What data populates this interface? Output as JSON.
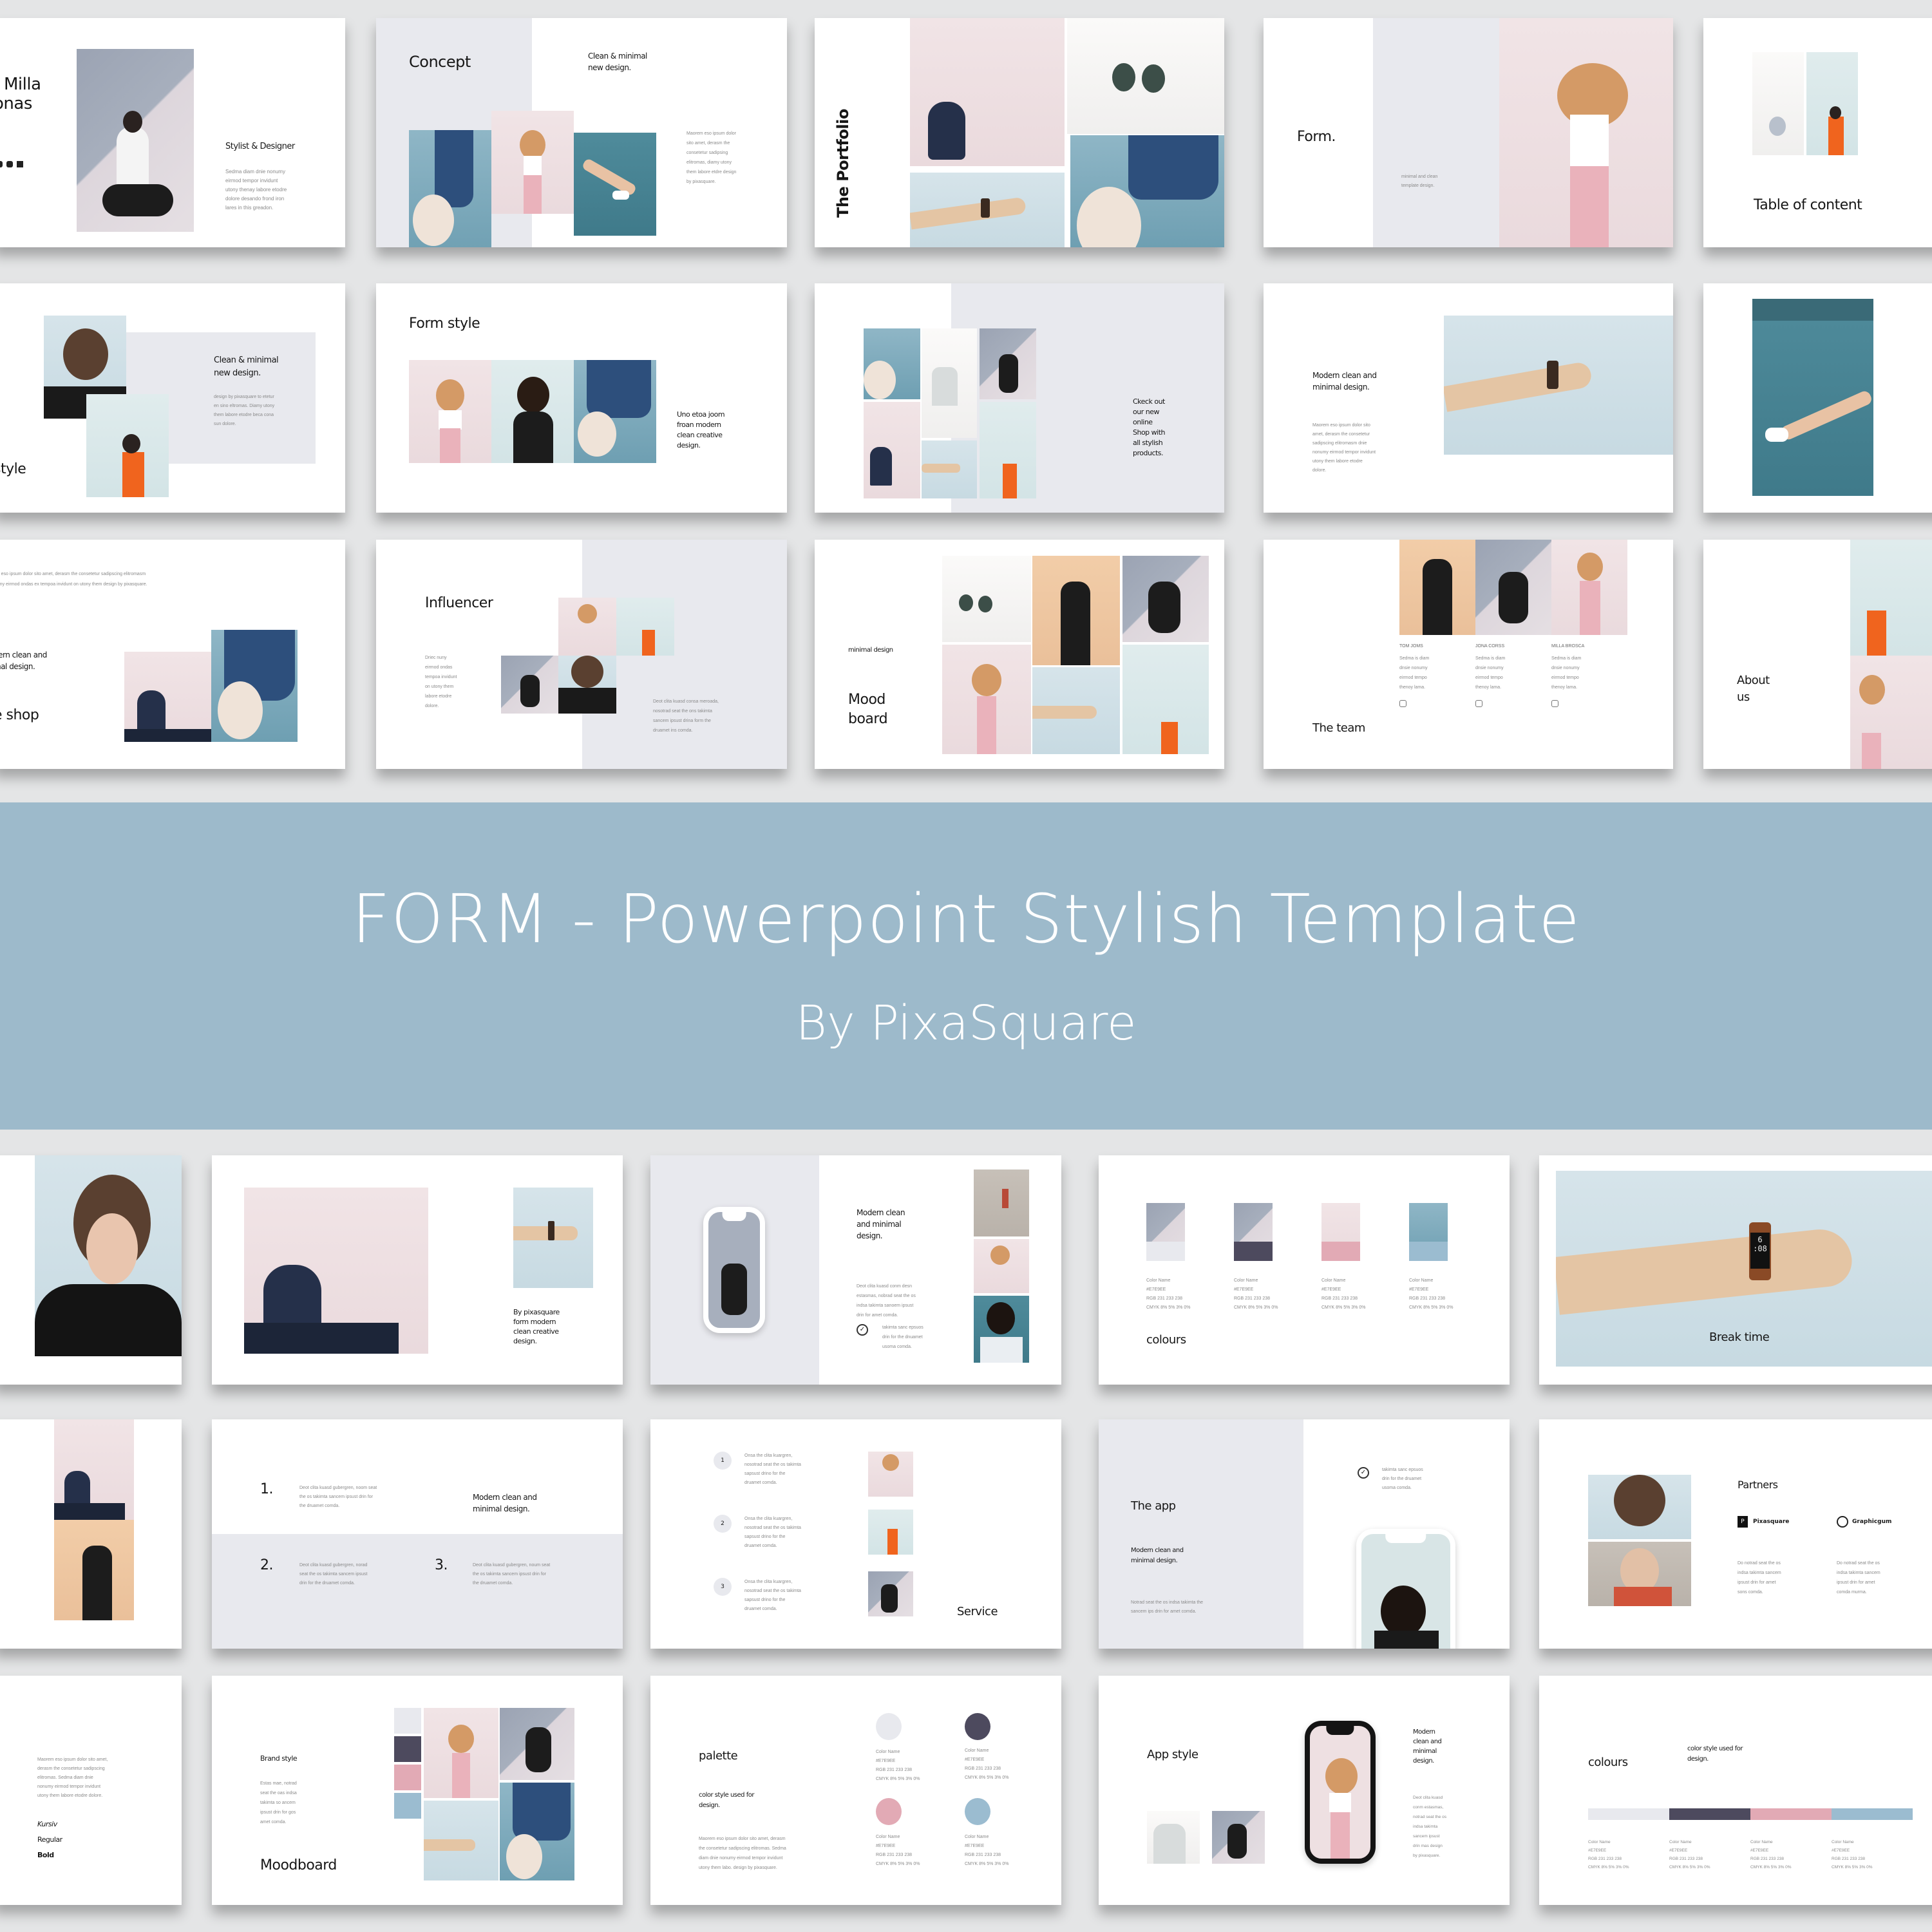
{
  "banner": {
    "title": "FORM - Powerpoint Stylish Template",
    "subtitle": "By PixaSquare",
    "color": "#9dbacb"
  },
  "palette": {
    "light_grey": "#e8e9ee",
    "dark_slate": "#4d4a5e",
    "pink": "#e2aab5",
    "blue": "#9bbcd0"
  },
  "slides_top": [
    {
      "id": "profile",
      "name_line1": "Milla",
      "name_line2": "onas",
      "subtitle": "Stylist & Designer",
      "body": "Sedma diam dnie nonumy\neirmod tempor invidunt\nutony thenay labore etodre\ndolore desando frond iron\nlares in this greadon.",
      "social_icons": [
        "instagram-icon",
        "youtube-icon",
        "mail-icon"
      ]
    },
    {
      "id": "concept",
      "title": "Concept",
      "heading": "Clean & minimal\nnew design.",
      "body": "Maorem eso ipsum dolor\nsito amet, derasm the\nconsetetur sadipsing\nelitromas, diamy utony\nthem labore etdre design\nby pixasquare."
    },
    {
      "id": "portfolio",
      "title": "The Portfolio"
    },
    {
      "id": "form",
      "title": "Form.",
      "body": "minimal and clean\ntemplate design."
    },
    {
      "id": "toc",
      "title": "Table of content"
    },
    {
      "id": "style",
      "title": "style",
      "heading": "Clean & minimal\nnew design.",
      "body": "design by pixasquare to etetur\nen sino eltromas. Diamy utony\nthem labore etodre beca cona\nsun dolore."
    },
    {
      "id": "form-style",
      "title": "Form style",
      "body": "Uno etoa joom\nfroan modern\nclean creative\ndesign."
    },
    {
      "id": "shop-grid",
      "body": "Ckeck out\nour new\nonline\nShop with\nall stylish\nproducts."
    },
    {
      "id": "modern-watch",
      "heading": "Modern clean and\nminimal design.",
      "body": "Maorem eso ipsum dolor sito\namet, derasm the consetetur\nsadipscing elitromasm dnie\nnonumy eirmod tempor invidunt\nutony them labore etodre\ndolore."
    },
    {
      "id": "legs"
    },
    {
      "id": "shop",
      "intro": "em eso ipsum dolor sito amet, derasm the consetetur sadipscing elitromasm\nnumy eirmod ondas ex tempoa invidunt on utony them design by pixasquare.",
      "heading": "dern clean and\nmal design.",
      "title": "e shop"
    },
    {
      "id": "influencer",
      "title": "Influencer",
      "body": "Driec nuny\neirmod ondas\ntempoa invidunt\non utony them\nlabore etodre\ndolore.",
      "body2": "Deot clita kuasd consa meroada,\nnosotrad seat the ons takimta\nsancem ipsust drina form the\ndruamet ins comda."
    },
    {
      "id": "moodboard",
      "caption": "minimal design",
      "title": "Mood\nboard"
    },
    {
      "id": "team",
      "title": "The team",
      "members": [
        {
          "name": "TOM JOMS",
          "bio": "Sedma is diam\ndnsie nonumy\neirmod tempo\nthenoy lama."
        },
        {
          "name": "JONA CORSS",
          "bio": "Sedma is diam\ndnsie nonumy\neirmod tempo\nthenoy lama."
        },
        {
          "name": "MILLA BROSCA",
          "bio": "Sedma is diam\ndnsie nonumy\neirmod tempo\nthenoy lama."
        }
      ]
    },
    {
      "id": "about",
      "title": "About\nus"
    }
  ],
  "slides_bottom": [
    {
      "id": "portrait"
    },
    {
      "id": "pixasquare",
      "body": "By pixasquare\nform modern\nclean creative\ndesign."
    },
    {
      "id": "phone-modern",
      "heading": "Modern clean\nand minimal\ndesign.",
      "body": "Deot clita kuasd conm desn\nestasmas, nobrad seat the os\nindsa takimta sanoem ipsust\ndrin for amet comda.",
      "check_text": "takimta sanc epsuos\ndrin for the dnuamet\nusoma comda."
    },
    {
      "id": "colours-photos",
      "title": "colours",
      "swatches": [
        {
          "name": "Color Name",
          "hex": "#E7E9EE",
          "rgb": "RGB 231  233  238",
          "cmyk": "CMYK 8%  5%  3%  0%"
        },
        {
          "name": "Color Name",
          "hex": "#E7E9EE",
          "rgb": "RGB 231  233  238",
          "cmyk": "CMYK 8%  5%  3%  0%"
        },
        {
          "name": "Color Name",
          "hex": "#E7E9EE",
          "rgb": "RGB 231  233  238",
          "cmyk": "CMYK 8%  5%  3%  0%"
        },
        {
          "name": "Color Name",
          "hex": "#E7E9EE",
          "rgb": "RGB 231  233  238",
          "cmyk": "CMYK 8%  5%  3%  0%"
        }
      ]
    },
    {
      "id": "break",
      "title": "Break time",
      "watch_time": "6\n:08"
    },
    {
      "id": "speaker-man"
    },
    {
      "id": "numbered",
      "heading": "Modern clean and\nminimal design.",
      "items": [
        {
          "num": "1.",
          "text": "Deot clita kuasd gubergren, noom seat\nthe os takimta sancem ipsust drin for\nthe druamet comda."
        },
        {
          "num": "2.",
          "text": "Deot clita kuasd gubergren, norad\nseat the os takimta sancem ipsust\ndrin for the druamet comda."
        },
        {
          "num": "3.",
          "text": "Deot clita kuasd gubergren, noum seat\nthe os takimta sancem ipsust drin for\nthe druamet comda."
        }
      ]
    },
    {
      "id": "service",
      "title": "Service",
      "steps": [
        {
          "num": "1",
          "text": "Onsa the clita kuargren,\nnosotrad seat the os takimta\nsapsust drino for the\ndruamet comda."
        },
        {
          "num": "2",
          "text": "Onsa the clita kuargren,\nnosotrad seat the os takimta\nsapsust drino for the\ndruamet comda."
        },
        {
          "num": "3",
          "text": "Onsa the clita kuargren,\nnosotrad seat the os takimta\nsapsust drino for the\ndruamet comda."
        }
      ]
    },
    {
      "id": "the-app",
      "title": "The app",
      "heading": "Modern clean and\nminimal design.",
      "body": "Notrad seat the os indsa takimta the\nsancem ips drin for amet comda.",
      "check_text": "takimta sanc epsuos\ndrin for the druamet\nusoma comda."
    },
    {
      "id": "partners",
      "title": "Partners",
      "partners": [
        {
          "name": "Pixasquare",
          "body": "Do notrad seat the os\nindsa takimta sancem\nipsust drin for amet\nsons comda."
        },
        {
          "name": "Graphicgum",
          "body": "Do notrad seat the os\nindsa takimta sancem\nipsust drin for amet\ncomda murma."
        }
      ]
    },
    {
      "id": "fonts",
      "body": "Maorem eso ipsum dolor sito amet,\nderasm the consetetur sadipscing\nelitromas. Sedma diam dnie\nnonumy eirmod tempor invidunt\nutony them labore etodre dolore.",
      "styles": [
        "Kursiv",
        "Regular",
        "Bold"
      ]
    },
    {
      "id": "moodboard2",
      "heading": "Brand style",
      "body": "Estas mae, notrad\nseat the oas indsa\ntakimta so ancem\nipsust drin for gos\namet comda.",
      "title": "Moodboard"
    },
    {
      "id": "palette",
      "title": "palette",
      "heading": "color style used for\ndesign.",
      "body": "Maorem eso ipsum dolor sito amet, derasm\nthe consetetur sadipscing elitromas. Sedma\ndiam dnie nonumy eirmod tempor invidunt\nutony them labo. design by pixasquare.",
      "swatches": [
        {
          "name": "Color Name",
          "hex": "#E7E9EE",
          "rgb": "RGB 231  233  238",
          "cmyk": "CMYK 8%  5%  3%  0%"
        },
        {
          "name": "Color Name",
          "hex": "#E7E9EE",
          "rgb": "RGB 231  233  238",
          "cmyk": "CMYK 8%  5%  3%  0%"
        },
        {
          "name": "Color Name",
          "hex": "#E7E9EE",
          "rgb": "RGB 231  233  238",
          "cmyk": "CMYK 8%  5%  3%  0%"
        },
        {
          "name": "Color Name",
          "hex": "#E7E9EE",
          "rgb": "RGB 231  233  238",
          "cmyk": "CMYK 8%  5%  3%  0%"
        }
      ]
    },
    {
      "id": "app-style",
      "title": "App style",
      "heading": "Modern\nclean and\nminimal\ndesign.",
      "body": "Deot clita kuasd\nconm estasmas,\nnotrad seat the os\nindsa takimta\nsancem ipsust\ndrin mas design\nby pixasquare."
    },
    {
      "id": "colours-bar",
      "title": "colours",
      "heading": "color style used for\ndesign.",
      "swatches": [
        {
          "name": "Color Name",
          "hex": "#E7E9EE",
          "rgb": "RGB 231  233  238",
          "cmyk": "CMYK 8%  5%  3%  0%"
        },
        {
          "name": "Color Name",
          "hex": "#E7E9EE",
          "rgb": "RGB 231  233  238",
          "cmyk": "CMYK 8%  5%  3%  0%"
        },
        {
          "name": "Color Name",
          "hex": "#E7E9EE",
          "rgb": "RGB 231  233  238",
          "cmyk": "CMYK 8%  5%  3%  0%"
        },
        {
          "name": "Color Name",
          "hex": "#E7E9EE",
          "rgb": "RGB 231  233  238",
          "cmyk": "CMYK 8%  5%  3%  0%"
        }
      ]
    }
  ]
}
